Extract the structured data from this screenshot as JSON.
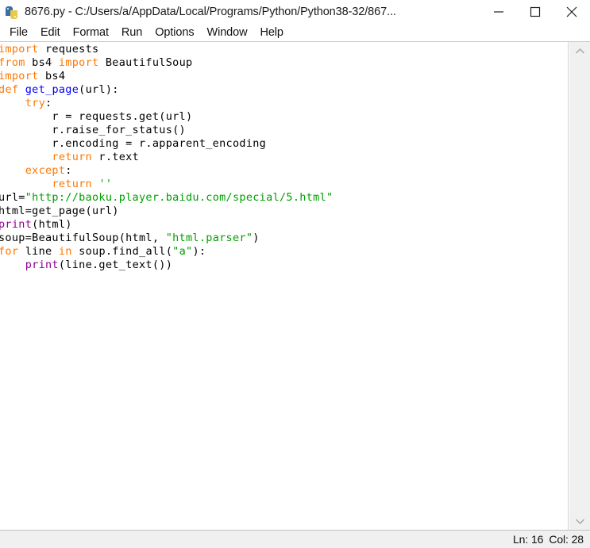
{
  "window": {
    "title": "8676.py - C:/Users/a/AppData/Local/Programs/Python/Python38-32/867...",
    "icon": "python-logo-icon",
    "controls": {
      "minimize": "minimize-icon",
      "maximize": "maximize-icon",
      "close": "close-icon"
    }
  },
  "menubar": {
    "items": [
      {
        "label": "File"
      },
      {
        "label": "Edit"
      },
      {
        "label": "Format"
      },
      {
        "label": "Run"
      },
      {
        "label": "Options"
      },
      {
        "label": "Window"
      },
      {
        "label": "Help"
      }
    ]
  },
  "editor": {
    "language": "python",
    "filename": "8676.py",
    "lines": [
      "import requests",
      "from bs4 import BeautifulSoup",
      "import bs4",
      "def get_page(url):",
      "    try:",
      "        r = requests.get(url)",
      "        r.raise_for_status()",
      "        r.encoding = r.apparent_encoding",
      "        return r.text",
      "    except:",
      "        return ''",
      "url=\"http://baoku.player.baidu.com/special/5.html\"",
      "html=get_page(url)",
      "print(html)",
      "soup=BeautifulSoup(html, \"html.parser\")",
      "for line in soup.find_all(\"a\"):",
      "    print(line.get_text())"
    ],
    "colors": {
      "keyword": "#ff7700",
      "definition": "#0000ff",
      "string": "#00a000",
      "builtin": "#900090",
      "text": "#000000",
      "background": "#ffffff"
    }
  },
  "scrollbar": {
    "up_arrow": "chevron-up-icon",
    "down_arrow": "chevron-down-icon"
  },
  "statusbar": {
    "line_label": "Ln: 16",
    "col_label": "Col: 28"
  }
}
